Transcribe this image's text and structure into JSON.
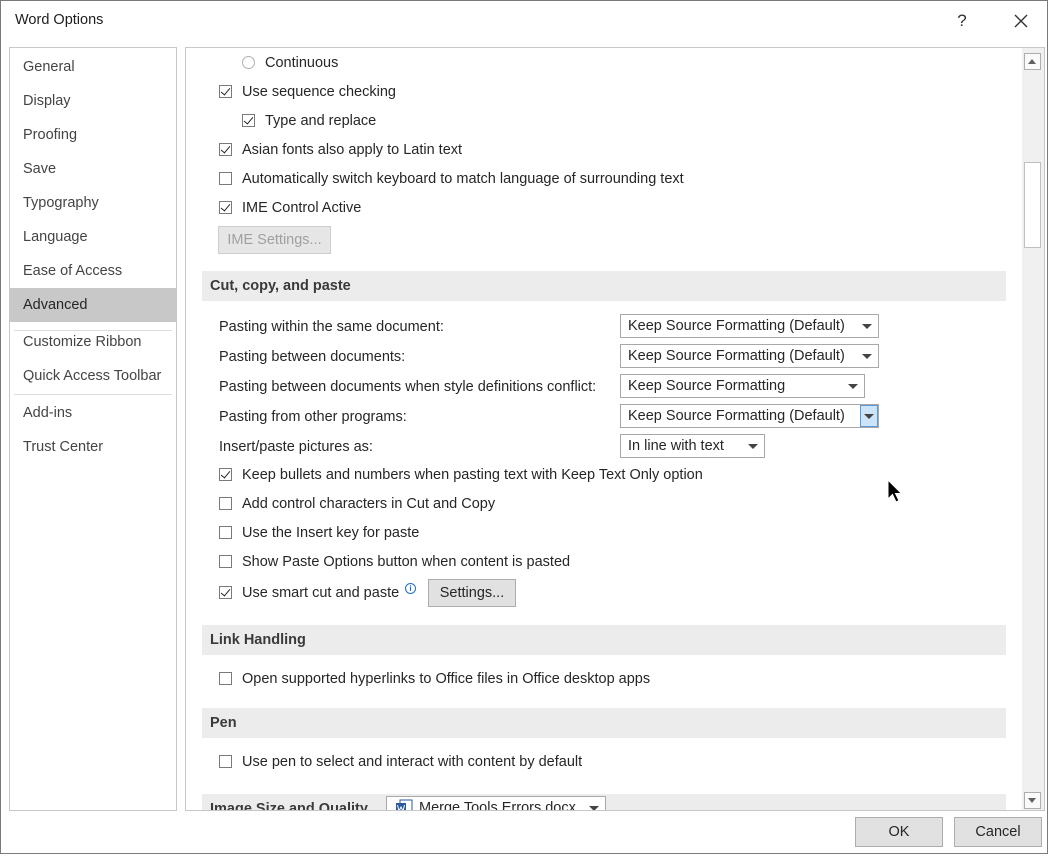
{
  "window": {
    "title": "Word Options",
    "help_label": "?"
  },
  "nav": {
    "items": [
      {
        "label": "General"
      },
      {
        "label": "Display"
      },
      {
        "label": "Proofing"
      },
      {
        "label": "Save"
      },
      {
        "label": "Typography"
      },
      {
        "label": "Language"
      },
      {
        "label": "Ease of Access"
      },
      {
        "label": "Advanced",
        "selected": true
      },
      {
        "label": "Customize Ribbon"
      },
      {
        "label": "Quick Access Toolbar"
      },
      {
        "label": "Add-ins"
      },
      {
        "label": "Trust Center"
      }
    ]
  },
  "top_options": {
    "continuous_label": "Continuous",
    "sequence_checking_label": "Use sequence checking",
    "type_replace_label": "Type and replace",
    "asian_fonts_label": "Asian fonts also apply to Latin text",
    "auto_switch_label": "Automatically switch keyboard to match language of surrounding text",
    "ime_active_label": "IME Control Active",
    "ime_settings_button": "IME Settings..."
  },
  "cut_copy_paste": {
    "heading": "Cut, copy, and paste",
    "within_doc_label": "Pasting within the same document:",
    "within_doc_value": "Keep Source Formatting (Default)",
    "between_docs_label": "Pasting between documents:",
    "between_docs_value": "Keep Source Formatting (Default)",
    "conflict_label": "Pasting between documents when style definitions conflict:",
    "conflict_value": "Keep Source Formatting",
    "other_programs_label": "Pasting from other programs:",
    "other_programs_value": "Keep Source Formatting (Default)",
    "pictures_label": "Insert/paste pictures as:",
    "pictures_value": "In line with text",
    "keep_bullets_label": "Keep bullets and numbers when pasting text with Keep Text Only option",
    "control_chars_label": "Add control characters in Cut and Copy",
    "insert_key_label": "Use the Insert key for paste",
    "paste_options_label": "Show Paste Options button when content is pasted",
    "smart_cut_label": "Use smart cut and paste",
    "info_glyph": "i",
    "settings_button": "Settings..."
  },
  "link_handling": {
    "heading": "Link Handling",
    "open_hyperlinks_label": "Open supported hyperlinks to Office files in Office desktop apps"
  },
  "pen": {
    "heading": "Pen",
    "use_pen_label": "Use pen to select and interact with content by default"
  },
  "image_size": {
    "heading": "Image Size and Quality",
    "document_value": "Merge Tools Errors.docx"
  },
  "footer": {
    "ok_label": "OK",
    "cancel_label": "Cancel"
  },
  "colors": {
    "selected_nav": "#c8c8c8",
    "section_bg": "#ececec",
    "word_blue": "#2b579a",
    "focus_blue": "#5b9bd5"
  }
}
